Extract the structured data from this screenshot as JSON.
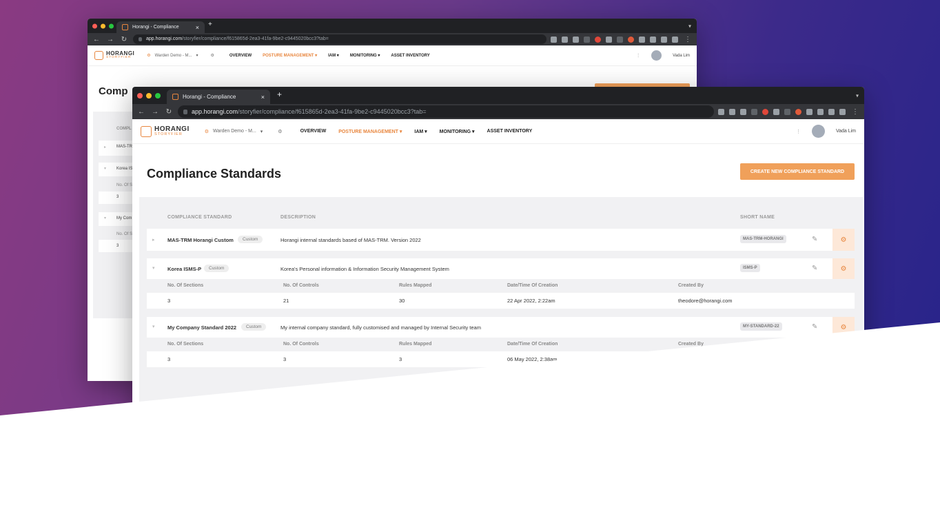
{
  "browser": {
    "tab_title": "Horangi - Compliance",
    "url_host": "app.horangi.com",
    "url_path": "/storyfier/compliance/f615865d-2ea3-41fa-9be2-c9445020bcc3?tab="
  },
  "app": {
    "logo_top": "HORANGI",
    "logo_bottom": "STORYFIER",
    "environment": "Warden Demo - M...",
    "menu": [
      {
        "label": "OVERVIEW"
      },
      {
        "label": "POSTURE MANAGEMENT ▾"
      },
      {
        "label": "IAM ▾"
      },
      {
        "label": "MONITORING ▾"
      },
      {
        "label": "ASSET INVENTORY"
      }
    ],
    "user_name": "Vada Lim"
  },
  "page": {
    "title": "Compliance Standards",
    "title_back_partial": "Comp",
    "create_button": "CREATE NEW COMPLIANCE STANDARD",
    "columns": {
      "standard": "COMPLIANCE STANDARD",
      "description": "DESCRIPTION",
      "short_name": "SHORT NAME",
      "back_partial": "COMPL"
    },
    "detail_columns": {
      "sections": "No. Of Sections",
      "controls": "No. Of Controls",
      "rules": "Rules Mapped",
      "created": "Date/Time Of Creation",
      "created_by": "Created By"
    },
    "standards": [
      {
        "name": "MAS-TRM Horangi Custom",
        "back_name": "MAS-TR",
        "badge": "Custom",
        "description": "Horangi internal standards based of MAS-TRM. Version 2022",
        "short_name": "MAS-TRM-HORANGI"
      },
      {
        "name": "Korea ISMS-P",
        "back_name": "Korea IS",
        "badge": "Custom",
        "description": "Korea's Personal information & Information Security Management System",
        "short_name": "ISMS-P",
        "details": {
          "sections": "3",
          "controls": "21",
          "rules": "30",
          "created": "22 Apr 2022, 2:22am",
          "created_by": "theodore@horangi.com"
        }
      },
      {
        "name": "My Company Standard 2022",
        "back_name": "My Com",
        "badge": "Custom",
        "description": "My internal company standard, fully customised and managed by Internal Security team",
        "short_name": "MY-STANDARD-22",
        "details": {
          "sections": "3",
          "controls": "3",
          "rules": "3",
          "created": "06 May 2022, 2:38am",
          "created_by": ""
        }
      }
    ],
    "back_sub_label": "No. Of S"
  },
  "icons": {
    "close": "×",
    "new_tab": "+",
    "back": "←",
    "forward": "→",
    "reload": "↻",
    "lock": "🔒",
    "gear": "⚙",
    "edit": "✎",
    "caret_right": "▸",
    "caret_down": "▾",
    "kebab": "⋮"
  },
  "colors": {
    "accent": "#e8863e",
    "button": "#f0a05a",
    "gear_cell": "#fde8d8"
  }
}
